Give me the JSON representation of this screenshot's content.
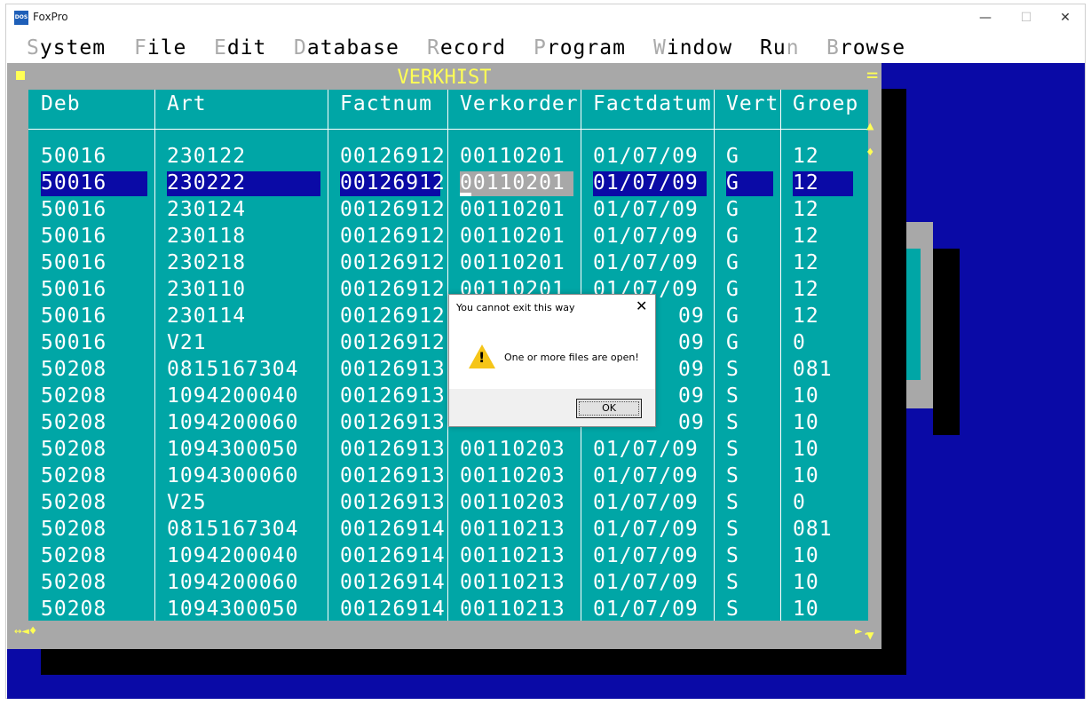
{
  "window": {
    "title": "FoxPro",
    "icon_text": "DOS"
  },
  "menu": [
    {
      "hotkey": "S",
      "rest": "ystem"
    },
    {
      "hotkey": "F",
      "rest": "ile"
    },
    {
      "hotkey": "E",
      "rest": "dit"
    },
    {
      "hotkey": "D",
      "rest": "atabase"
    },
    {
      "hotkey": "R",
      "rest": "ecord"
    },
    {
      "hotkey": "P",
      "rest": "rogram"
    },
    {
      "hotkey": "W",
      "rest": "indow"
    },
    {
      "hotkey": "n",
      "rest": "Ru",
      "hotkey_last": true
    },
    {
      "hotkey": "B",
      "rest": "rowse"
    }
  ],
  "browse": {
    "title": "VERKHIST",
    "columns": [
      "Deb",
      "Art",
      "Factnum",
      "Verkorder",
      "Factdatum",
      "Vert",
      "Groep"
    ],
    "rows": [
      [
        "50016",
        "230122",
        "00126912",
        "00110201",
        "01/07/09",
        "G",
        "12"
      ],
      [
        "50016",
        "230222",
        "00126912",
        "00110201",
        "01/07/09",
        "G",
        "12"
      ],
      [
        "50016",
        "230124",
        "00126912",
        "00110201",
        "01/07/09",
        "G",
        "12"
      ],
      [
        "50016",
        "230118",
        "00126912",
        "00110201",
        "01/07/09",
        "G",
        "12"
      ],
      [
        "50016",
        "230218",
        "00126912",
        "00110201",
        "01/07/09",
        "G",
        "12"
      ],
      [
        "50016",
        "230110",
        "00126912",
        "00110201",
        "01/07/09",
        "G",
        "12"
      ],
      [
        "50016",
        "230114",
        "00126912",
        "",
        "09",
        "G",
        "12"
      ],
      [
        "50016",
        "V21",
        "00126912",
        "",
        "09",
        "G",
        "0"
      ],
      [
        "50208",
        "0815167304",
        "00126913",
        "",
        "09",
        "S",
        "081"
      ],
      [
        "50208",
        "1094200040",
        "00126913",
        "",
        "09",
        "S",
        "10"
      ],
      [
        "50208",
        "1094200060",
        "00126913",
        "",
        "09",
        "S",
        "10"
      ],
      [
        "50208",
        "1094300050",
        "00126913",
        "00110203",
        "01/07/09",
        "S",
        "10"
      ],
      [
        "50208",
        "1094300060",
        "00126913",
        "00110203",
        "01/07/09",
        "S",
        "10"
      ],
      [
        "50208",
        "V25",
        "00126913",
        "00110203",
        "01/07/09",
        "S",
        "0"
      ],
      [
        "50208",
        "0815167304",
        "00126914",
        "00110213",
        "01/07/09",
        "S",
        "081"
      ],
      [
        "50208",
        "1094200040",
        "00126914",
        "00110213",
        "01/07/09",
        "S",
        "10"
      ],
      [
        "50208",
        "1094200060",
        "00126914",
        "00110213",
        "01/07/09",
        "S",
        "10"
      ],
      [
        "50208",
        "1094300050",
        "00126914",
        "00110213",
        "01/07/09",
        "S",
        "10"
      ]
    ],
    "selected_row": 1,
    "active_column": 3,
    "scroll_up": "▲",
    "scroll_down": "▼",
    "scroll_thumb": "♦",
    "hscroll_left": "↔◄♦",
    "hscroll_right": "►.",
    "zoom_glyph": "="
  },
  "dialog": {
    "title": "You cannot exit this way",
    "message": "One or more files are open!",
    "ok_label": "OK",
    "close_glyph": "✕",
    "icon": "warning-icon"
  },
  "colors": {
    "dos_blue": "#0a0aa6",
    "dos_teal": "#00a6a6",
    "dos_gray": "#a8a8a8",
    "dos_yellow": "#ffff55"
  }
}
